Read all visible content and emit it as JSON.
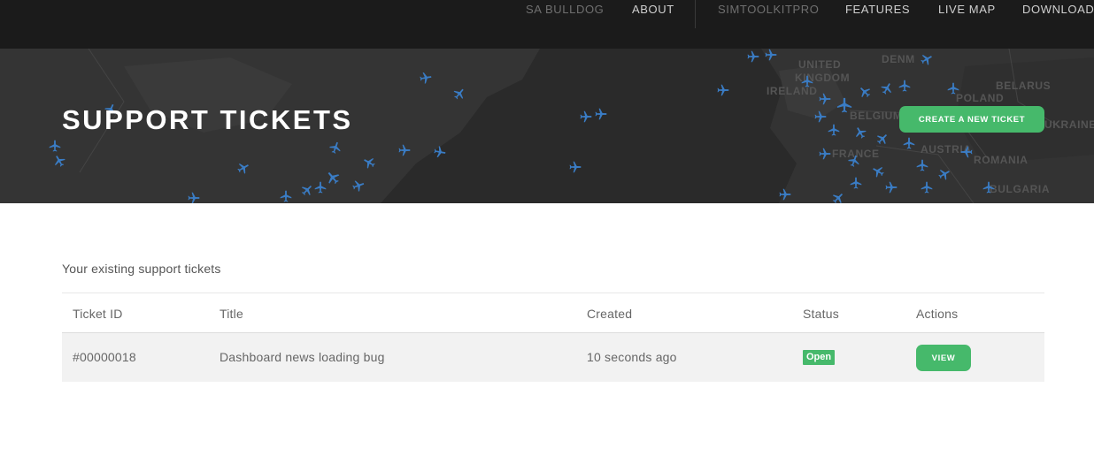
{
  "nav": {
    "items": [
      {
        "label": "SA BULLDOG"
      },
      {
        "label": "ABOUT"
      },
      {
        "label": "SIMTOOLKITPRO"
      },
      {
        "label": "FEATURES"
      },
      {
        "label": "LIVE MAP"
      },
      {
        "label": "DOWNLOAD"
      }
    ]
  },
  "hero": {
    "title": "SUPPORT TICKETS",
    "cta_label": "CREATE A NEW TICKET",
    "map_labels": [
      "UNITED",
      "KINGDOM",
      "IRELAND",
      "DENM",
      "BELARUS",
      "POLAND",
      "BELGIUM",
      "FRANCE",
      "AUSTRIA",
      "ROMANIA",
      "BULGARIA",
      "UKRAINE"
    ]
  },
  "content": {
    "intro": "Your existing support tickets",
    "table": {
      "columns": [
        "Ticket ID",
        "Title",
        "Created",
        "Status",
        "Actions"
      ],
      "rows": [
        {
          "id": "#00000018",
          "title": "Dashboard news loading bug",
          "created": "10 seconds ago",
          "status": "Open",
          "action_label": "VIEW"
        }
      ]
    }
  },
  "colors": {
    "nav_bg": "#1b1b1b",
    "hero_bg": "#2a2a2a",
    "accent_green": "#46b96b",
    "plane_blue": "#3a7cc4",
    "row_bg": "#f2f2f2"
  },
  "icons": {
    "map_markers": "airplane-icon"
  }
}
